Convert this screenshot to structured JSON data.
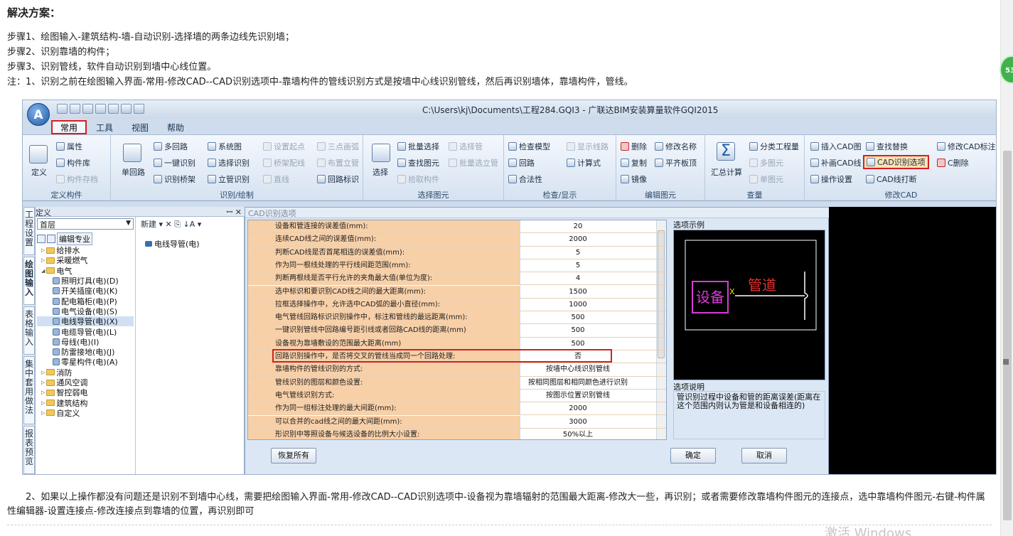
{
  "article": {
    "heading": "解决方案：",
    "steps": [
      "步骤1、绘图输入-建筑结构-墙-自动识别-选择墙的两条边线先识别墙；",
      "步骤2、识别靠墙的构件；",
      "步骤3、识别管线，软件自动识别到墙中心线位置。",
      "注：1、识别之前在绘图输入界面-常用-修改CAD--CAD识别选项中-靠墙构件的管线识别方式是按墙中心线识别管线，然后再识别墙体，靠墙构件，管线。"
    ],
    "paragraph2": "2、如果以上操作都没有问题还是识别不到墙中心线，需要把绘图输入界面-常用-修改CAD--CAD识别选项中-设备视为靠墙辐射的范围最大距离-修改大一些，再识别；或者需要修改靠墙构件图元的连接点，选中靠墙构件图元-右键-构件属性编辑器-设置连接点-修改连接点到靠墙的位置，再识别即可",
    "watermark": "激活 Windows",
    "badge": "53"
  },
  "app": {
    "orb": "A",
    "window_title": "C:\\Users\\kj\\Documents\\工程284.GQI3 - 广联达BIM安装算量软件GQI2015",
    "tabs": [
      "常用",
      "工具",
      "视图",
      "帮助"
    ]
  },
  "ribbon": {
    "define": {
      "label": "定义构件",
      "big": "定义",
      "items": [
        "属性",
        "构件库",
        "构件存档"
      ]
    },
    "draw": {
      "label": "识别/绘制",
      "big": "单回路",
      "items": [
        "多回路",
        "一键识别",
        "识别桥架",
        "系统图",
        "选择识别",
        "立管识别",
        "设置起点",
        "桥架配线",
        "直线",
        "三点画弧",
        "布置立管",
        "回路标识"
      ]
    },
    "select": {
      "label": "选择图元",
      "big": "选择",
      "items": [
        "批量选择",
        "查找图元",
        "拾取构件",
        "选择管",
        "批量选立管"
      ]
    },
    "check": {
      "label": "检查/显示",
      "items": [
        "检查模型",
        "回路",
        "合法性",
        "显示线路",
        "计算式"
      ]
    },
    "edit": {
      "label": "编辑图元",
      "items": [
        "删除",
        "复制",
        "镜像",
        "修改名称",
        "平齐板顶"
      ]
    },
    "sum": {
      "label": "汇总计算",
      "big": "汇总计算",
      "items": [
        "分类工程量",
        "多图元",
        "单图元"
      ]
    },
    "query_label": "查量",
    "cad": {
      "label": "修改CAD",
      "items": [
        "插入CAD图",
        "补画CAD线",
        "操作设置",
        "查找替换",
        "CAD识别选项",
        "CAD线打断",
        "修改CAD标注",
        "C删除"
      ]
    }
  },
  "left_panel": {
    "header": "定义",
    "pin": "ꟷ ✕",
    "floor": "首层",
    "vertical_tabs": [
      "工程设置",
      "绘图输入",
      "表格输入",
      "集中套用做法",
      "报表预览"
    ],
    "tree_toolbar": "编辑专业",
    "tree": [
      {
        "label": "给排水",
        "level": 1,
        "type": "folder"
      },
      {
        "label": "采暖燃气",
        "level": 1,
        "type": "folder"
      },
      {
        "label": "电气",
        "level": 1,
        "type": "folder"
      },
      {
        "label": "照明灯具(电)(D)",
        "level": 2,
        "type": "leaf"
      },
      {
        "label": "开关插座(电)(K)",
        "level": 2,
        "type": "leaf"
      },
      {
        "label": "配电箱柜(电)(P)",
        "level": 2,
        "type": "leaf"
      },
      {
        "label": "电气设备(电)(S)",
        "level": 2,
        "type": "leaf"
      },
      {
        "label": "电线导管(电)(X)",
        "level": 2,
        "type": "leaf",
        "selected": true
      },
      {
        "label": "电缆导管(电)(L)",
        "level": 2,
        "type": "leaf"
      },
      {
        "label": "母线(电)(I)",
        "level": 2,
        "type": "leaf"
      },
      {
        "label": "防雷接地(电)(J)",
        "level": 2,
        "type": "leaf"
      },
      {
        "label": "零星构件(电)(A)",
        "level": 2,
        "type": "leaf"
      },
      {
        "label": "消防",
        "level": 1,
        "type": "folder"
      },
      {
        "label": "通风空调",
        "level": 1,
        "type": "folder"
      },
      {
        "label": "智控弱电",
        "level": 1,
        "type": "folder"
      },
      {
        "label": "建筑结构",
        "level": 1,
        "type": "folder"
      },
      {
        "label": "自定义",
        "level": 1,
        "type": "folder"
      }
    ],
    "comp_toolbar": "新建 ▾ ✕ ⎘ ↓A ▾",
    "component": "电线导管(电)"
  },
  "dialog": {
    "title": "CAD识别选项",
    "rows": [
      {
        "k": "设备和管连接的误差值(mm):",
        "v": "20"
      },
      {
        "k": "连续CAD线之间的误差值(mm):",
        "v": "2000"
      },
      {
        "k": "判断CAD线是否首尾相连的误差值(mm):",
        "v": "5"
      },
      {
        "k": "作为同一根线处理的平行线间距范围(mm):",
        "v": "5"
      },
      {
        "k": "判断两根线是否平行允许的夹角最大值(单位为度):",
        "v": "4"
      },
      {
        "k": "选中标识和要识别CAD线之间的最大距离(mm):",
        "v": "1500"
      },
      {
        "k": "拉框选择操作中，允许选中CAD弧的最小直径(mm):",
        "v": "1000"
      },
      {
        "k": "电气管线回路标识识别操作中，标注和管线的最远距离(mm):",
        "v": "500"
      },
      {
        "k": "一键识别管线中回路编号距引线或者回路CAD线的距离(mm)",
        "v": "500"
      },
      {
        "k": "设备视为靠墙敷设的范围最大距离(mm)",
        "v": "500"
      },
      {
        "k": "回路识别操作中，是否将交叉的管线当成同一个回路处理:",
        "v": "否"
      },
      {
        "k": "靠墙构件的管线识别的方式:",
        "v": "按墙中心线识别管线"
      },
      {
        "k": "管线识别的图层和颜色设置:",
        "v": "按相同图层和相同颜色进行识别"
      },
      {
        "k": "电气管线识别方式:",
        "v": "按图示位置识别管线"
      },
      {
        "k": "作为同一组标注处理的最大间距(mm):",
        "v": "2000"
      },
      {
        "k": "可以合并的cad线之间的最大间距(mm):",
        "v": "3000"
      },
      {
        "k": "形识别中等照设备与候选设备的比例大小设置:",
        "v": "50%以上"
      }
    ],
    "example_label": "选项示例",
    "example_device": "设备",
    "example_pipe": "管道",
    "example_x": "X",
    "explain_label": "选项说明",
    "explain_text": "管识别过程中设备和管的距离误差(距离在这个范围内则认为管是和设备相连的)",
    "btn_restore": "恢复所有",
    "btn_ok": "确定",
    "btn_cancel": "取消"
  }
}
